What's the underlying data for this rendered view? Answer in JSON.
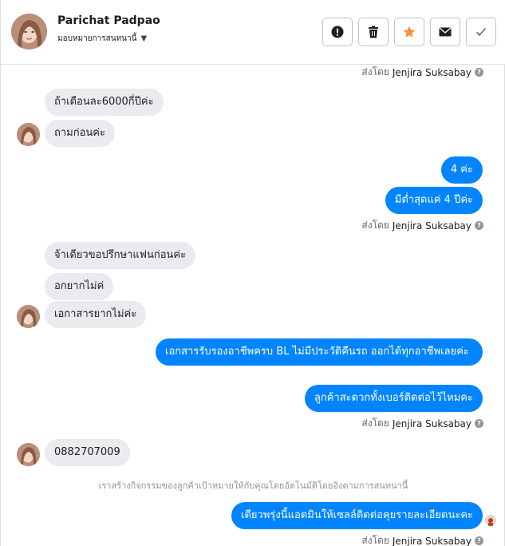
{
  "header": {
    "contact_name": "Parichat Padpao",
    "assign_label": "มอบหมายการสนทนานี้"
  },
  "toolbar": {
    "buttons": [
      "mark-spam",
      "delete",
      "star",
      "mark-unread",
      "mark-done"
    ]
  },
  "sent_by_prefix": "ส่งโดย",
  "agent_name": "Jenjira Suksabay",
  "messages": {
    "in1": "ถ้าเดือนละ6000กี่ปีค่ะ",
    "in2": "ถามก่อนค่ะ",
    "out1": "4 ค่ะ",
    "out2": "มีต่ำสุดแค่ 4 ปีค่ะ",
    "in3": "จ้าเดียวขอปรึกษาแฟนก่อนค่ะ",
    "in4": "อกยากไม่ค่",
    "in5": "เอกาสารยากไม่ค่ะ",
    "out3": "เอกสารรับรองอาชีพครบ BL ไม่มีประวัติคืนรถ ออกได้ทุกอาชีพเลยค่ะ",
    "out4": "ลูกค้าสะดวกทั้งเบอร์ติดต่อไว้ไหมคะ",
    "in6": "0882707009",
    "out5": "เดียวพรุ่งนี้แอดมินให้เซลล์ติดต่อคุยรายละเอียดนะคะ"
  },
  "system_note": "เราสร้างกิจกรรมของลูกค้าเป้าหมายให้กับคุณโดยอัตโนมัติโดยอิงตามการสนทนานี้",
  "colors": {
    "outgoing_bubble": "#0084ff",
    "incoming_bubble": "#e9ebee",
    "star": "#f7923b"
  }
}
